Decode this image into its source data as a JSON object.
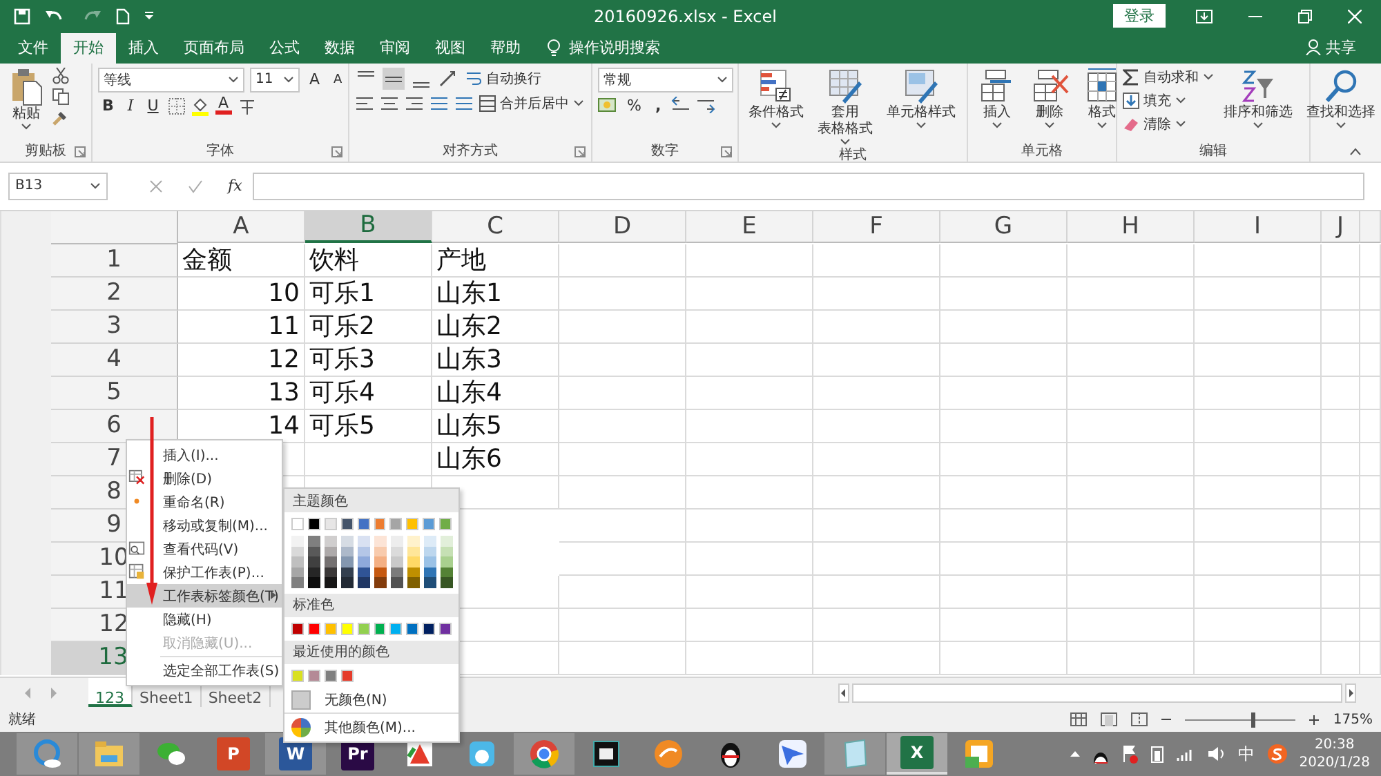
{
  "window": {
    "title": "20160926.xlsx  -  Excel",
    "sign_in": "登录"
  },
  "tabs": [
    {
      "label": "文件",
      "selected": false
    },
    {
      "label": "开始",
      "selected": true
    },
    {
      "label": "插入",
      "selected": false
    },
    {
      "label": "页面布局",
      "selected": false
    },
    {
      "label": "公式",
      "selected": false
    },
    {
      "label": "数据",
      "selected": false
    },
    {
      "label": "审阅",
      "selected": false
    },
    {
      "label": "视图",
      "selected": false
    },
    {
      "label": "帮助",
      "selected": false
    }
  ],
  "tell_me": "操作说明搜索",
  "share": "共享",
  "ribbon": {
    "groups": [
      {
        "kind": "clipboard",
        "label": "剪贴板",
        "paste": "粘贴"
      },
      {
        "kind": "font",
        "label": "字体",
        "font_name": "等线",
        "font_size": "11",
        "grow": "A",
        "shrink": "A",
        "bold": "B",
        "italic": "I",
        "underline": "U",
        "font_color": "A"
      },
      {
        "kind": "alignment",
        "label": "对齐方式",
        "wrap": "自动换行",
        "merge": "合并后居中",
        "vertical_align": [
          {
            "selected": false
          },
          {
            "selected": true
          },
          {
            "selected": false
          }
        ]
      },
      {
        "kind": "number",
        "label": "数字",
        "format": "常规",
        "percent": "%",
        "comma": ","
      },
      {
        "kind": "styles",
        "label": "样式",
        "buttons": [
          {
            "lines": [
              "条件格式"
            ]
          },
          {
            "lines": [
              "套用",
              "表格格式"
            ]
          },
          {
            "lines": [
              "单元格样式"
            ]
          }
        ]
      },
      {
        "kind": "cells",
        "label": "单元格",
        "buttons": [
          {
            "lines": [
              "插入"
            ]
          },
          {
            "lines": [
              "删除"
            ]
          },
          {
            "lines": [
              "格式"
            ]
          }
        ]
      },
      {
        "kind": "editing",
        "label": "编辑",
        "small": [
          {
            "text": "自动求和"
          },
          {
            "text": "填充"
          },
          {
            "text": "清除"
          }
        ],
        "buttons": [
          {
            "lines": [
              "排序和筛选"
            ]
          },
          {
            "lines": [
              "查找和选择"
            ]
          }
        ]
      }
    ]
  },
  "formula_bar": {
    "name_box": "B13",
    "fx": "fx"
  },
  "sheet": {
    "columns": [
      {
        "label": "A",
        "selected": false
      },
      {
        "label": "B",
        "selected": true
      },
      {
        "label": "C",
        "selected": false
      },
      {
        "label": "D",
        "selected": false
      },
      {
        "label": "E",
        "selected": false
      },
      {
        "label": "F",
        "selected": false
      },
      {
        "label": "G",
        "selected": false
      },
      {
        "label": "H",
        "selected": false
      },
      {
        "label": "I",
        "selected": false
      },
      {
        "label": "J",
        "selected": false
      }
    ],
    "rows": [
      {
        "header": "1",
        "selected": false,
        "cells": [
          {
            "text": "金额",
            "kind": "text"
          },
          {
            "text": "饮料",
            "kind": "text"
          },
          {
            "text": "产地",
            "kind": "text"
          }
        ]
      },
      {
        "header": "2",
        "selected": false,
        "cells": [
          {
            "text": "10",
            "kind": "number"
          },
          {
            "text": "可乐1",
            "kind": "text"
          },
          {
            "text": "山东1",
            "kind": "text"
          }
        ]
      },
      {
        "header": "3",
        "selected": false,
        "cells": [
          {
            "text": "11",
            "kind": "number"
          },
          {
            "text": "可乐2",
            "kind": "text"
          },
          {
            "text": "山东2",
            "kind": "text"
          }
        ]
      },
      {
        "header": "4",
        "selected": false,
        "cells": [
          {
            "text": "12",
            "kind": "number"
          },
          {
            "text": "可乐3",
            "kind": "text"
          },
          {
            "text": "山东3",
            "kind": "text"
          }
        ]
      },
      {
        "header": "5",
        "selected": false,
        "cells": [
          {
            "text": "13",
            "kind": "number"
          },
          {
            "text": "可乐4",
            "kind": "text"
          },
          {
            "text": "山东4",
            "kind": "text"
          }
        ]
      },
      {
        "header": "6",
        "selected": false,
        "cells": [
          {
            "text": "14",
            "kind": "number"
          },
          {
            "text": "可乐5",
            "kind": "text"
          },
          {
            "text": "山东5",
            "kind": "text"
          }
        ]
      },
      {
        "header": "7",
        "selected": false,
        "cells": [
          null,
          null,
          {
            "text": "山东6",
            "kind": "text"
          }
        ]
      },
      {
        "header": "8",
        "selected": false,
        "cells": []
      },
      {
        "header": "9",
        "selected": false,
        "cells": []
      },
      {
        "header": "10",
        "selected": false,
        "cells": []
      },
      {
        "header": "11",
        "selected": false,
        "cells": []
      },
      {
        "header": "12",
        "selected": false,
        "cells": []
      },
      {
        "header": "13",
        "selected": true,
        "cells": []
      }
    ]
  },
  "sheet_tabs": [
    {
      "label": "123",
      "selected": true
    },
    {
      "label": "Sheet1",
      "selected": false
    },
    {
      "label": "Sheet2",
      "selected": false
    }
  ],
  "status_bar": {
    "status": "就绪",
    "zoom": {
      "level": 0.6,
      "reading": "175%"
    }
  },
  "context_menu": {
    "items": [
      {
        "text": "插入(I)...",
        "kind": "plain",
        "disabled": false,
        "selected": false
      },
      {
        "text": "删除(D)",
        "kind": "delete",
        "disabled": false,
        "selected": false
      },
      {
        "text": "重命名(R)",
        "kind": "rename",
        "disabled": false,
        "selected": false
      },
      {
        "text": "移动或复制(M)...",
        "kind": "plain",
        "disabled": false,
        "selected": false
      },
      {
        "text": "查看代码(V)",
        "kind": "code",
        "disabled": false,
        "selected": false
      },
      {
        "text": "保护工作表(P)...",
        "kind": "protect",
        "disabled": false,
        "selected": false
      },
      {
        "text": "工作表标签颜色(T)",
        "kind": "submenu",
        "disabled": false,
        "selected": true
      },
      {
        "text": "隐藏(H)",
        "kind": "plain",
        "disabled": false,
        "selected": false
      },
      {
        "text": "取消隐藏(U)...",
        "kind": "plain",
        "disabled": true,
        "selected": false
      },
      {
        "text": "选定全部工作表(S)",
        "kind": "plain",
        "disabled": false,
        "selected": false,
        "separator_before": true
      }
    ]
  },
  "color_menu": {
    "theme_title": "主题颜色",
    "theme_colors": [
      {
        "color": "#ffffff",
        "shades": [
          {
            "color": "#f2f2f2"
          },
          {
            "color": "#d9d9d9"
          },
          {
            "color": "#bfbfbf"
          },
          {
            "color": "#a6a6a6"
          },
          {
            "color": "#808080"
          }
        ]
      },
      {
        "color": "#000000",
        "shades": [
          {
            "color": "#7f7f7f"
          },
          {
            "color": "#595959"
          },
          {
            "color": "#404040"
          },
          {
            "color": "#262626"
          },
          {
            "color": "#0d0d0d"
          }
        ]
      },
      {
        "color": "#e7e6e6",
        "shades": [
          {
            "color": "#d0cece"
          },
          {
            "color": "#aeaaaa"
          },
          {
            "color": "#757171"
          },
          {
            "color": "#3b3838"
          },
          {
            "color": "#171616"
          }
        ]
      },
      {
        "color": "#44546a",
        "shades": [
          {
            "color": "#d6dce4"
          },
          {
            "color": "#adb9ca"
          },
          {
            "color": "#8497b0"
          },
          {
            "color": "#333f4f"
          },
          {
            "color": "#222a35"
          }
        ]
      },
      {
        "color": "#4472c4",
        "shades": [
          {
            "color": "#d9e1f2"
          },
          {
            "color": "#b4c6e7"
          },
          {
            "color": "#8ea9db"
          },
          {
            "color": "#305496"
          },
          {
            "color": "#203764"
          }
        ]
      },
      {
        "color": "#ed7d31",
        "shades": [
          {
            "color": "#fce4d6"
          },
          {
            "color": "#f8cbad"
          },
          {
            "color": "#f4b084"
          },
          {
            "color": "#c65911"
          },
          {
            "color": "#833c0c"
          }
        ]
      },
      {
        "color": "#a5a5a5",
        "shades": [
          {
            "color": "#ededed"
          },
          {
            "color": "#dbdbdb"
          },
          {
            "color": "#c9c9c9"
          },
          {
            "color": "#7b7b7b"
          },
          {
            "color": "#525252"
          }
        ]
      },
      {
        "color": "#ffc000",
        "shades": [
          {
            "color": "#fff2cc"
          },
          {
            "color": "#ffe699"
          },
          {
            "color": "#ffd966"
          },
          {
            "color": "#bf8f00"
          },
          {
            "color": "#806000"
          }
        ]
      },
      {
        "color": "#5b9bd5",
        "shades": [
          {
            "color": "#ddebf7"
          },
          {
            "color": "#bdd7ee"
          },
          {
            "color": "#9bc2e6"
          },
          {
            "color": "#2f75b5"
          },
          {
            "color": "#1f4e78"
          }
        ]
      },
      {
        "color": "#70ad47",
        "shades": [
          {
            "color": "#e2efda"
          },
          {
            "color": "#c6e0b4"
          },
          {
            "color": "#a9d08e"
          },
          {
            "color": "#548235"
          },
          {
            "color": "#375623"
          }
        ]
      }
    ],
    "standard_title": "标准色",
    "standard_colors": [
      {
        "color": "#c00000"
      },
      {
        "color": "#ff0000"
      },
      {
        "color": "#ffc000"
      },
      {
        "color": "#ffff00"
      },
      {
        "color": "#92d050"
      },
      {
        "color": "#00b050"
      },
      {
        "color": "#00b0f0"
      },
      {
        "color": "#0070c0"
      },
      {
        "color": "#002060"
      },
      {
        "color": "#7030a0"
      }
    ],
    "recent_title": "最近使用的颜色",
    "recent_colors": [
      {
        "color": "#d9e021"
      },
      {
        "color": "#b48a96"
      },
      {
        "color": "#7f7f7f"
      },
      {
        "color": "#e53c2b"
      }
    ],
    "no_color": "无颜色(N)",
    "more_colors": "其他颜色(M)..."
  },
  "taskbar": {
    "apps": [
      {
        "kind": "browser",
        "running": true,
        "active": false
      },
      {
        "kind": "folder",
        "running": true,
        "active": false
      },
      {
        "kind": "chat",
        "running": false,
        "active": false
      },
      {
        "kind": "letter",
        "glyph": "P",
        "color": "#d24726",
        "running": false,
        "active": false
      },
      {
        "kind": "letter",
        "glyph": "W",
        "color": "#2b579a",
        "running": true,
        "active": false
      },
      {
        "kind": "letter",
        "glyph": "Pr",
        "color": "#2a0a45",
        "running": false,
        "active": false
      },
      {
        "kind": "wps",
        "running": false,
        "active": false
      },
      {
        "kind": "bunny",
        "running": false,
        "active": false
      },
      {
        "kind": "chrome",
        "running": true,
        "active": false
      },
      {
        "kind": "film",
        "running": false,
        "active": false
      },
      {
        "kind": "orange",
        "running": false,
        "active": false
      },
      {
        "kind": "penguin",
        "running": false,
        "active": false
      },
      {
        "kind": "bird",
        "running": false,
        "active": false
      },
      {
        "kind": "notepad",
        "running": true,
        "active": false
      },
      {
        "kind": "letter",
        "glyph": "X",
        "color": "#217346",
        "running": true,
        "active": true
      },
      {
        "kind": "board",
        "running": false,
        "active": false
      }
    ],
    "ime": "中",
    "time": "20:38",
    "date": "2020/1/28"
  }
}
